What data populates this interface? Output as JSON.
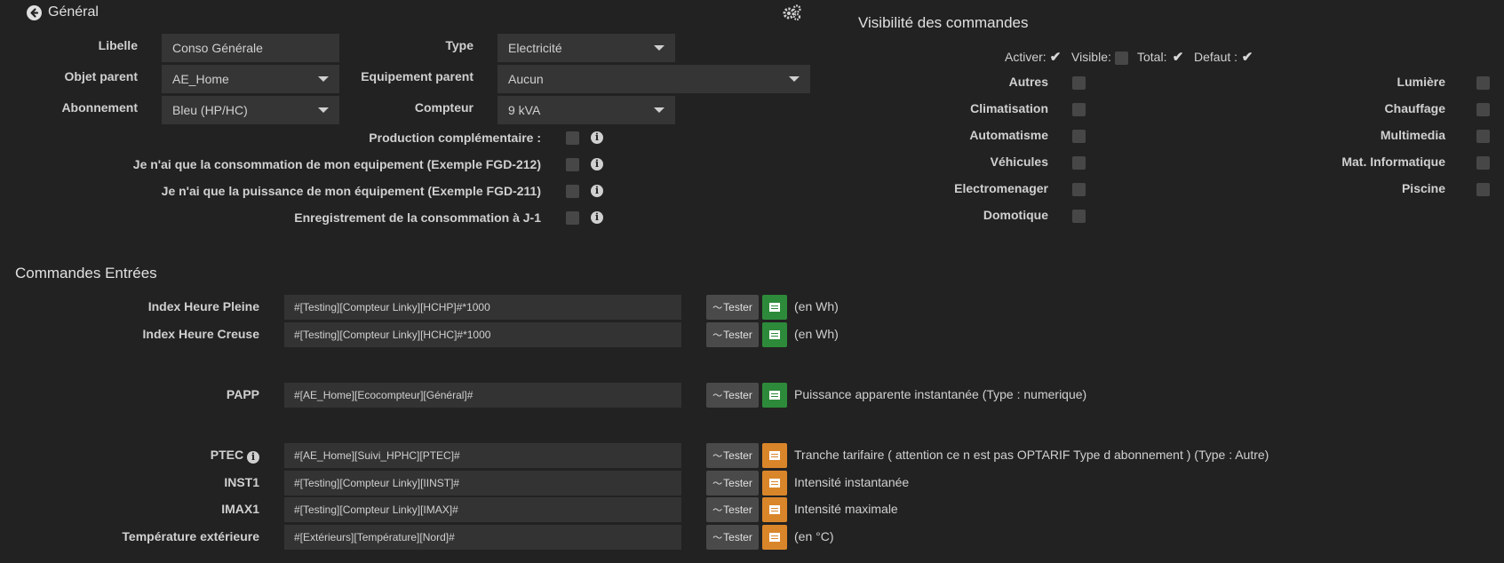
{
  "header": {
    "back_title": "Général"
  },
  "general": {
    "libelle_label": "Libelle",
    "libelle_value": "Conso Générale",
    "type_label": "Type",
    "type_value": "Electricité",
    "objet_parent_label": "Objet parent",
    "objet_parent_value": "AE_Home",
    "equipement_parent_label": "Equipement parent",
    "equipement_parent_value": "Aucun",
    "abonnement_label": "Abonnement",
    "abonnement_value": "Bleu (HP/HC)",
    "compteur_label": "Compteur",
    "compteur_value": "9 kVA",
    "options": [
      {
        "label": "Production complémentaire :",
        "checked": false
      },
      {
        "label": "Je n'ai que la consommation de mon equipement (Exemple FGD-212)",
        "checked": false
      },
      {
        "label": "Je n'ai que la puissance de mon équipement (Exemple FGD-211)",
        "checked": false
      },
      {
        "label": "Enregistrement de la consommation à J-1",
        "checked": false
      }
    ]
  },
  "visibility": {
    "title": "Visibilité des commandes",
    "activer_label": "Activer:",
    "activer_checked": true,
    "visible_label": "Visible:",
    "visible_checked": false,
    "total_label": "Total:",
    "total_checked": true,
    "defaut_label": "Defaut :",
    "defaut_checked": true,
    "left_categories": [
      "Autres",
      "Climatisation",
      "Automatisme",
      "Véhicules",
      "Electromenager",
      "Domotique"
    ],
    "right_categories": [
      "Lumière",
      "Chauffage",
      "Multimedia",
      "Mat. Informatique",
      "Piscine"
    ]
  },
  "commands": {
    "title": "Commandes Entrées",
    "tester_label": "Tester",
    "rows": [
      {
        "label": "Index Heure Pleine",
        "value": "#[Testing][Compteur Linky][HCHP]#*1000",
        "desc": "(en Wh)",
        "color": "#2d8a3a"
      },
      {
        "label": "Index Heure Creuse",
        "value": "#[Testing][Compteur Linky][HCHC]#*1000",
        "desc": "(en Wh)",
        "color": "#2d8a3a"
      },
      {
        "label": "PAPP",
        "value": "#[AE_Home][Ecocompteur][Général]#",
        "desc": "Puissance apparente instantanée (Type : numerique)",
        "color": "#2d8a3a"
      },
      {
        "label": "PTEC",
        "value": "#[AE_Home][Suivi_HPHC][PTEC]#",
        "desc": "Tranche tarifaire ( attention ce n est pas OPTARIF Type d abonnement ) (Type : Autre)",
        "color": "#d9862a"
      },
      {
        "label": "INST1",
        "value": "#[Testing][Compteur Linky][IINST]#",
        "desc": "Intensité instantanée",
        "color": "#d9862a"
      },
      {
        "label": "IMAX1",
        "value": "#[Testing][Compteur Linky][IMAX]#",
        "desc": "Intensité maximale",
        "color": "#d9862a"
      },
      {
        "label": "Température extérieure",
        "value": "#[Extérieurs][Température][Nord]#",
        "desc": "(en °C)",
        "color": "#d9862a"
      }
    ]
  }
}
